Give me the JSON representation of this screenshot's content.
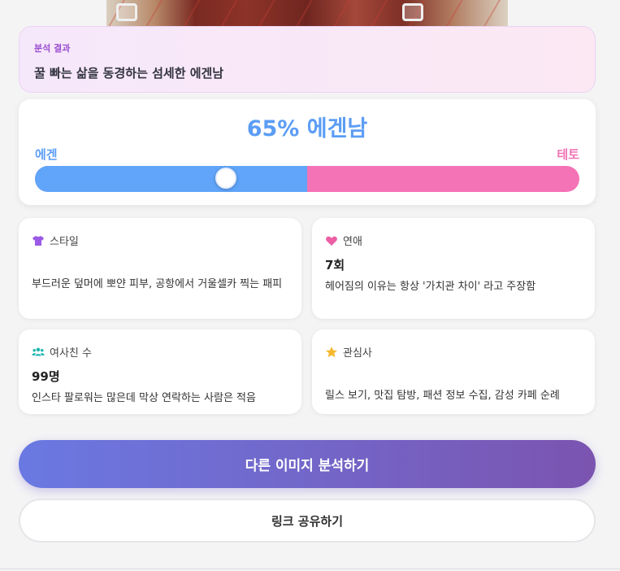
{
  "result": {
    "label": "분석 결과",
    "text": "꿀 빠는 삶을 동경하는 섬세한 에겐남"
  },
  "meter": {
    "title": "65% 에겐남",
    "left_label": "에겐",
    "right_label": "테토",
    "egen_fraction": 0.5,
    "thumb_position": 0.35,
    "colors": {
      "left": "#60a5fa",
      "right": "#f472b6"
    }
  },
  "cards": {
    "style": {
      "icon": "shirt-icon",
      "title": "스타일",
      "value": "",
      "desc": "부드러운 덮머에 뽀얀 피부, 공항에서 거울셀카 찍는 패피"
    },
    "love": {
      "icon": "heart-icon",
      "title": "연애",
      "value": "7회",
      "desc": "헤어짐의 이유는 항상 '가치관 차이' 라고 주장함"
    },
    "friends": {
      "icon": "users-icon",
      "title": "여사친 수",
      "value": "99명",
      "desc": "인스타 팔로워는 많은데 막상 연락하는 사람은 적음"
    },
    "interest": {
      "icon": "star-icon",
      "title": "관심사",
      "value": "",
      "desc": "릴스 보기, 맛집 탐방, 패션 정보 수집, 감성 카페 순례"
    }
  },
  "buttons": {
    "retry": "다른 이미지 분석하기",
    "share": "링크 공유하기"
  }
}
